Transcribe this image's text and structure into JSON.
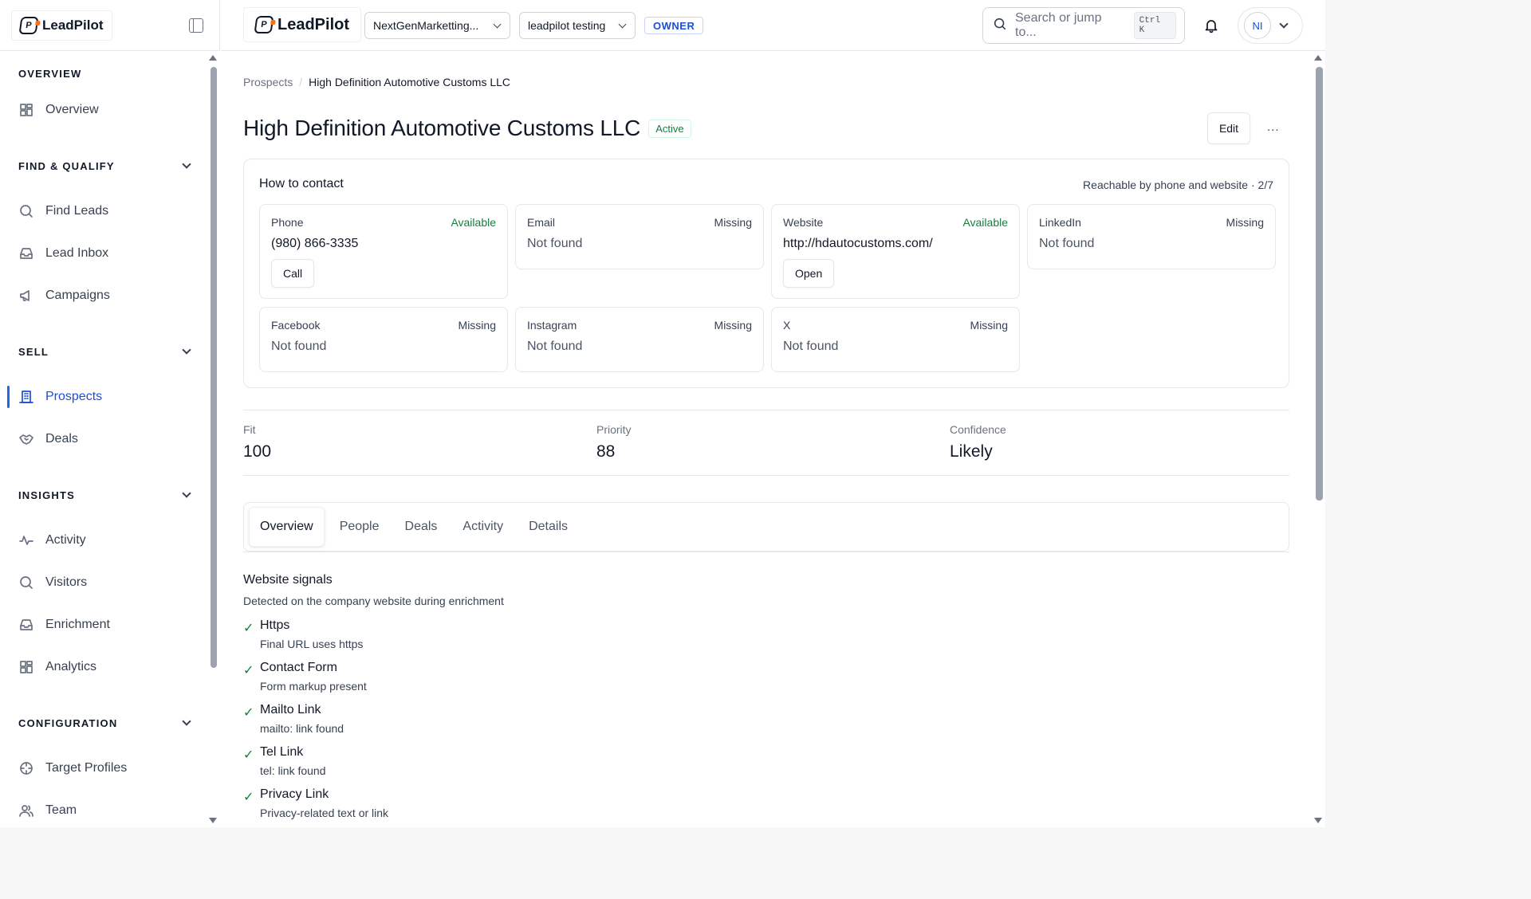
{
  "brand": {
    "name": "LeadPilot",
    "mark_letter": "P"
  },
  "sidebar": {
    "sections": [
      {
        "title": "OVERVIEW",
        "collapsible": false,
        "items": [
          {
            "label": "Overview",
            "icon": "grid-icon"
          }
        ]
      },
      {
        "title": "FIND & QUALIFY",
        "collapsible": true,
        "items": [
          {
            "label": "Find Leads",
            "icon": "search-icon"
          },
          {
            "label": "Lead Inbox",
            "icon": "inbox-icon"
          },
          {
            "label": "Campaigns",
            "icon": "megaphone-icon"
          }
        ]
      },
      {
        "title": "SELL",
        "collapsible": true,
        "items": [
          {
            "label": "Prospects",
            "icon": "building-icon",
            "active": true
          },
          {
            "label": "Deals",
            "icon": "handshake-icon"
          }
        ]
      },
      {
        "title": "INSIGHTS",
        "collapsible": true,
        "items": [
          {
            "label": "Activity",
            "icon": "pulse-icon"
          },
          {
            "label": "Visitors",
            "icon": "search-icon"
          },
          {
            "label": "Enrichment",
            "icon": "inbox-icon"
          },
          {
            "label": "Analytics",
            "icon": "grid-icon"
          }
        ]
      },
      {
        "title": "CONFIGURATION",
        "collapsible": true,
        "items": [
          {
            "label": "Target Profiles",
            "icon": "target-icon"
          },
          {
            "label": "Team",
            "icon": "users-icon"
          }
        ]
      }
    ]
  },
  "topbar": {
    "workspace": "NextGenMarketting...",
    "project": "leadpilot testing",
    "role": "OWNER",
    "search_placeholder": "Search or jump to...",
    "search_shortcut": "Ctrl K",
    "user_initials": "NI"
  },
  "breadcrumb": {
    "parent": "Prospects",
    "separator": "/",
    "current": "High Definition Automotive Customs LLC"
  },
  "company": {
    "name": "High Definition Automotive Customs LLC",
    "status": "Active"
  },
  "actions": {
    "edit": "Edit",
    "more": "..."
  },
  "contact": {
    "title": "How to contact",
    "summary": "Reachable by phone and website · 2/7",
    "channels": [
      {
        "label": "Phone",
        "status": "Available",
        "value": "(980) 866-3335",
        "action": "Call"
      },
      {
        "label": "Email",
        "status": "Missing",
        "value": "Not found"
      },
      {
        "label": "Website",
        "status": "Available",
        "value": "http://hdautocustoms.com/",
        "action": "Open"
      },
      {
        "label": "LinkedIn",
        "status": "Missing",
        "value": "Not found"
      },
      {
        "label": "Facebook",
        "status": "Missing",
        "value": "Not found"
      },
      {
        "label": "Instagram",
        "status": "Missing",
        "value": "Not found"
      },
      {
        "label": "X",
        "status": "Missing",
        "value": "Not found"
      }
    ]
  },
  "metrics": [
    {
      "label": "Fit",
      "value": "100"
    },
    {
      "label": "Priority",
      "value": "88"
    },
    {
      "label": "Confidence",
      "value": "Likely"
    }
  ],
  "tabs": [
    {
      "label": "Overview",
      "active": true
    },
    {
      "label": "People"
    },
    {
      "label": "Deals"
    },
    {
      "label": "Activity"
    },
    {
      "label": "Details"
    }
  ],
  "signals": {
    "title": "Website signals",
    "subtitle": "Detected on the company website during enrichment",
    "check_glyph": "✓",
    "items": [
      {
        "name": "Https",
        "detail": "Final URL uses https"
      },
      {
        "name": "Contact Form",
        "detail": "Form markup present"
      },
      {
        "name": "Mailto Link",
        "detail": "mailto: link found"
      },
      {
        "name": "Tel Link",
        "detail": "tel: link found"
      },
      {
        "name": "Privacy Link",
        "detail": "Privacy-related text or link"
      }
    ]
  },
  "colors": {
    "accent": "#1d4ed8",
    "available": "#15803d",
    "brand_orange": "#f97316"
  }
}
